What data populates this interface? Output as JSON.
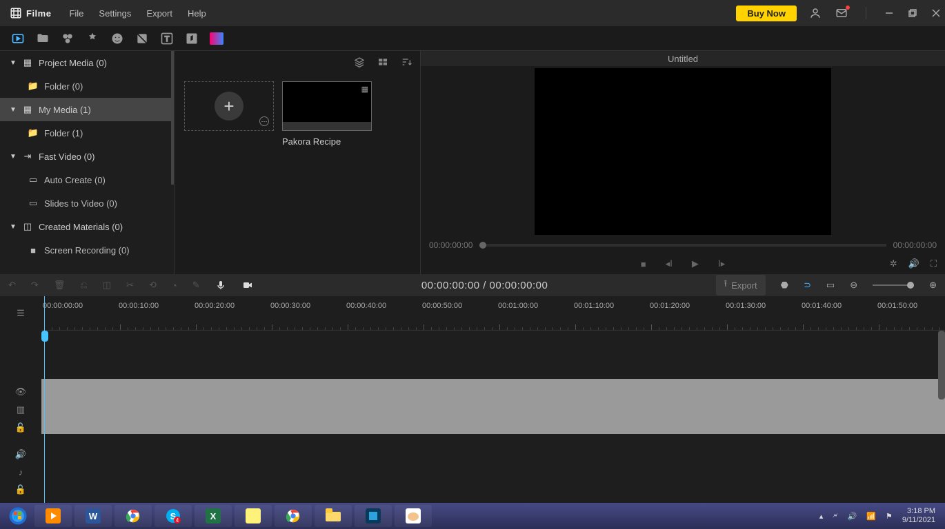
{
  "app": {
    "name": "Filme"
  },
  "menu": {
    "file": "File",
    "settings": "Settings",
    "export": "Export",
    "help": "Help"
  },
  "titlebar": {
    "buynow": "Buy Now"
  },
  "sidebar": {
    "project_media": "Project Media (0)",
    "project_folder": "Folder (0)",
    "my_media": "My Media (1)",
    "my_folder": "Folder (1)",
    "fast_video": "Fast Video (0)",
    "auto_create": "Auto Create (0)",
    "slides": "Slides to Video (0)",
    "created": "Created Materials (0)",
    "screen_rec": "Screen Recording (0)"
  },
  "media": {
    "clip1_name": "Pakora Recipe"
  },
  "preview": {
    "title": "Untitled",
    "time_left": "00:00:00:00",
    "time_right": "00:00:00:00"
  },
  "tlbar": {
    "timecode": "00:00:00:00 / 00:00:00:00",
    "export": "Export"
  },
  "ruler": {
    "t0": "00:00:00:00",
    "t1": "00:00:10:00",
    "t2": "00:00:20:00",
    "t3": "00:00:30:00",
    "t4": "00:00:40:00",
    "t5": "00:00:50:00",
    "t6": "00:01:00:00",
    "t7": "00:01:10:00",
    "t8": "00:01:20:00",
    "t9": "00:01:30:00",
    "t10": "00:01:40:00",
    "t11": "00:01:50:00"
  },
  "taskbar": {
    "time": "3:18 PM",
    "date": "9/11/2021"
  }
}
